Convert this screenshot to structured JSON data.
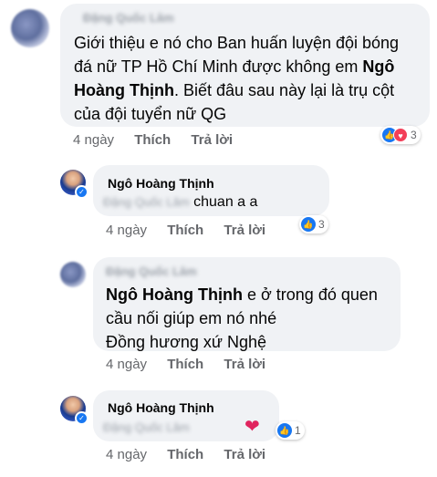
{
  "comments": [
    {
      "author": "Đặng Quốc Lâm",
      "text_prefix": "Giới thiệu e nó cho Ban huấn luyện đội bóng",
      "text_line2_a": "đá nữ TP Hồ Chí Minh được không em ",
      "text_mention_a": "Ngô",
      "text_mention_b": "Hoàng Thịnh",
      "text_line3_rest": ". Biết đâu sau này lại là trụ cột",
      "text_line4": "của đội tuyển nữ QG",
      "time": "4 ngày",
      "like": "Thích",
      "reply": "Trả lời",
      "reaction_count": "3"
    },
    {
      "author": "Ngô Hoàng Thịnh",
      "mention": "Đặng Quốc Lâm",
      "text": "chuan a a",
      "time": "4 ngày",
      "like": "Thích",
      "reply": "Trả lời",
      "reaction_count": "3"
    },
    {
      "author": "Đặng Quốc Lâm",
      "mention": "Ngô Hoàng Thịnh",
      "text_line1": " e ở trong đó quen",
      "text_line2": "cầu nối giúp em nó nhé",
      "text_line3": " Đồng hương xứ Nghệ",
      "time": "4 ngày",
      "like": "Thích",
      "reply": "Trả lời"
    },
    {
      "author": "Ngô Hoàng Thịnh",
      "mention": "Đặng Quốc Lâm",
      "emoji": "❤",
      "time": "4 ngày",
      "like": "Thích",
      "reply": "Trả lời",
      "reaction_count": "1"
    }
  ],
  "icons": {
    "like": "like-icon",
    "love": "love-icon",
    "heart": "heart-emoji",
    "verified": "verified-badge-icon"
  },
  "colors": {
    "bubble": "#f0f2f5",
    "meta": "#65676b",
    "like": "#1877f2",
    "love": "#f33e58"
  }
}
